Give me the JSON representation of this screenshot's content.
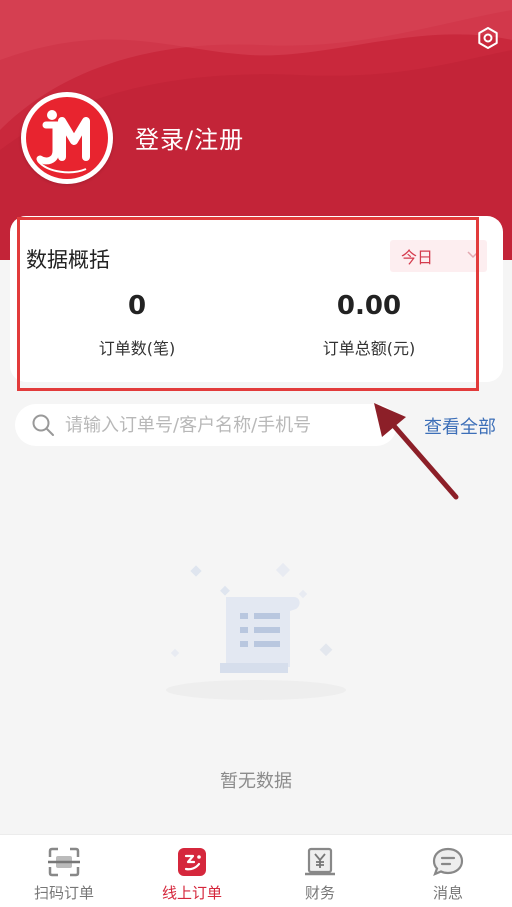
{
  "header": {
    "login_text": "登录/注册"
  },
  "overview": {
    "title": "数据概括",
    "period": "今日",
    "order_count": "0",
    "order_count_label": "订单数(笔)",
    "order_amount": "0.00",
    "order_amount_label": "订单总额(元)"
  },
  "search": {
    "placeholder": "请输入订单号/客户名称/手机号",
    "value": "",
    "view_all": "查看全部"
  },
  "empty": {
    "text": "暂无数据"
  },
  "tabbar": {
    "tabs": [
      {
        "label": "扫码订单",
        "icon": "scan-icon"
      },
      {
        "label": "线上订单",
        "icon": "online-order-icon"
      },
      {
        "label": "财务",
        "icon": "finance-icon"
      },
      {
        "label": "消息",
        "icon": "message-icon"
      }
    ],
    "active_index": 1
  },
  "colors": {
    "brand_red": "#c9283c",
    "link_blue": "#3d6fb8",
    "highlight_red": "#e23b3b"
  }
}
